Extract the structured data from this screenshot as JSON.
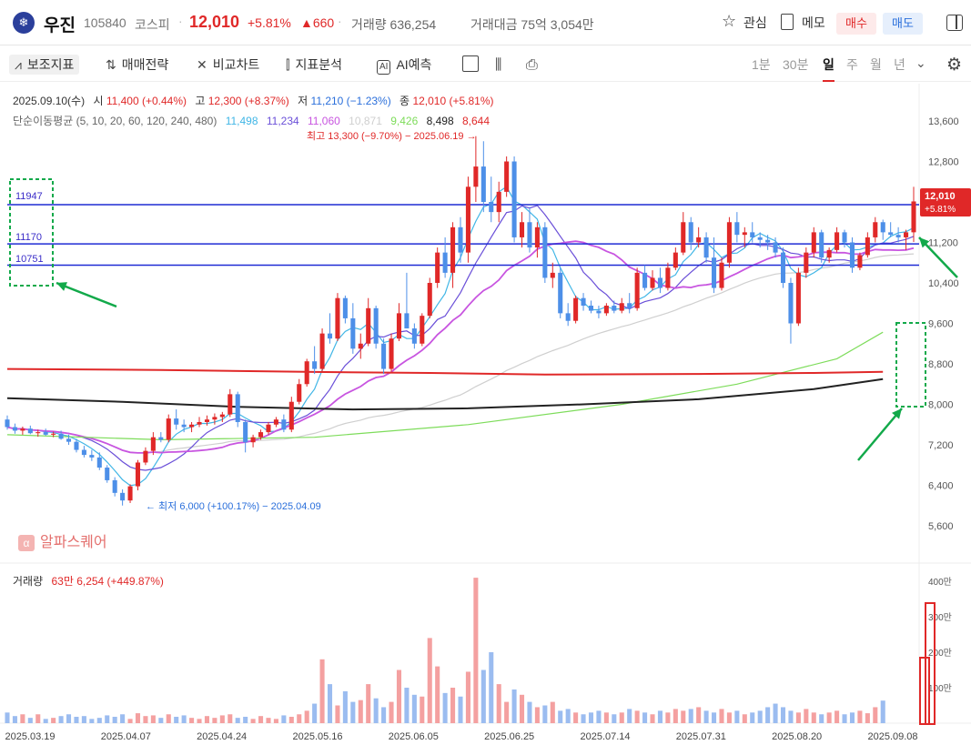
{
  "header": {
    "name": "우진",
    "code": "105840",
    "market": "코스피",
    "price": "12,010",
    "change_pct": "+5.81%",
    "change_abs": "▲660",
    "volume": "거래량 636,254",
    "amount": "거래대금 75억 3,054만",
    "watch_label": "관심",
    "memo_label": "메모",
    "buy_label": "매수",
    "sell_label": "매도"
  },
  "toolbar": {
    "indicators": "보조지표",
    "strategy": "매매전략",
    "compare": "비교차트",
    "analysis": "지표분석",
    "ai": "AI예측",
    "periods": [
      "1분",
      "30분",
      "일",
      "주",
      "월",
      "년"
    ],
    "active_period": "일"
  },
  "info": {
    "date": "2025.09.10(수)",
    "open_label": "시",
    "open": "11,400 (+0.44%)",
    "high_label": "고",
    "high": "12,300 (+8.37%)",
    "low_label": "저",
    "low": "11,210 (−1.23%)",
    "close_label": "종",
    "close": "12,010 (+5.81%)",
    "ma_label": "단순이동평균 (5, 10, 20, 60, 120, 240, 480)",
    "ma_values": [
      {
        "value": "11,498",
        "color": "#41b6e6"
      },
      {
        "value": "11,234",
        "color": "#6a4fd8"
      },
      {
        "value": "11,060",
        "color": "#c855e0"
      },
      {
        "value": "10,871",
        "color": "#cfcfcf"
      },
      {
        "value": "9,426",
        "color": "#7ddc5a"
      },
      {
        "value": "8,498",
        "color": "#222222"
      },
      {
        "value": "8,644",
        "color": "#e02828"
      }
    ]
  },
  "annotations": {
    "high": "최고 13,300 (−9.70%) − 2025.06.19 →",
    "low": "← 최저 6,000 (+100.17%) − 2025.04.09",
    "box_levels": [
      "11947",
      "11170",
      "10751"
    ],
    "price_tag": "12,010",
    "price_tag_pct": "+5.81%"
  },
  "watermark": "알파스퀘어",
  "volume_info": {
    "label": "거래량",
    "value": "63만 6,254 (+449.87%)"
  },
  "colors": {
    "up": "#e02828",
    "down": "#4d8fe8",
    "hline": "#1f2bd4",
    "annotation": "#12a94a"
  },
  "chart_data": {
    "type": "candlestick",
    "price_axis": {
      "ticks": [
        "13,600",
        "12,800",
        "12,000",
        "11,200",
        "10,400",
        "9,600",
        "8,800",
        "8,000",
        "7,200",
        "6,400",
        "5,600"
      ],
      "ylim": [
        5200,
        14000
      ]
    },
    "volume_axis": {
      "ticks": [
        "400만",
        "300만",
        "200만",
        "100만"
      ]
    },
    "x_ticks": [
      "2025.03.19",
      "2025.04.07",
      "2025.04.24",
      "2025.05.16",
      "2025.06.05",
      "2025.06.25",
      "2025.07.14",
      "2025.07.31",
      "2025.08.20",
      "2025.09.08"
    ],
    "horizontal_lines": [
      11947,
      11170,
      10751
    ],
    "ohlc": [
      [
        7700,
        7780,
        7500,
        7550
      ],
      [
        7550,
        7620,
        7420,
        7480
      ],
      [
        7480,
        7560,
        7400,
        7520
      ],
      [
        7520,
        7580,
        7410,
        7430
      ],
      [
        7430,
        7500,
        7360,
        7450
      ],
      [
        7450,
        7520,
        7380,
        7400
      ],
      [
        7400,
        7460,
        7350,
        7420
      ],
      [
        7420,
        7480,
        7300,
        7320
      ],
      [
        7320,
        7400,
        7200,
        7260
      ],
      [
        7260,
        7320,
        7050,
        7100
      ],
      [
        7100,
        7180,
        6950,
        7000
      ],
      [
        7000,
        7100,
        6880,
        6950
      ],
      [
        6950,
        7050,
        6700,
        6750
      ],
      [
        6750,
        6800,
        6450,
        6500
      ],
      [
        6500,
        6560,
        6180,
        6250
      ],
      [
        6250,
        6320,
        6000,
        6100
      ],
      [
        6100,
        6420,
        6050,
        6380
      ],
      [
        6380,
        6900,
        6300,
        6850
      ],
      [
        6850,
        7150,
        6800,
        7080
      ],
      [
        7080,
        7450,
        7000,
        7350
      ],
      [
        7350,
        7450,
        7250,
        7300
      ],
      [
        7300,
        7800,
        7250,
        7720
      ],
      [
        7720,
        7900,
        7500,
        7600
      ],
      [
        7600,
        7700,
        7450,
        7550
      ],
      [
        7550,
        7650,
        7450,
        7600
      ],
      [
        7600,
        7750,
        7550,
        7650
      ],
      [
        7650,
        7780,
        7580,
        7700
      ],
      [
        7700,
        7820,
        7600,
        7750
      ],
      [
        7750,
        7850,
        7650,
        7800
      ],
      [
        7800,
        8300,
        7750,
        8200
      ],
      [
        8200,
        8250,
        7550,
        7650
      ],
      [
        7650,
        7700,
        7050,
        7250
      ],
      [
        7250,
        7400,
        7150,
        7350
      ],
      [
        7350,
        7500,
        7300,
        7450
      ],
      [
        7450,
        7650,
        7400,
        7600
      ],
      [
        7600,
        7750,
        7550,
        7700
      ],
      [
        7700,
        7800,
        7450,
        7500
      ],
      [
        7500,
        8150,
        7450,
        8050
      ],
      [
        8050,
        8500,
        8000,
        8400
      ],
      [
        8400,
        8900,
        8350,
        8850
      ],
      [
        8850,
        9150,
        8600,
        8700
      ],
      [
        8700,
        9500,
        8650,
        9400
      ],
      [
        9400,
        9800,
        9200,
        9300
      ],
      [
        9300,
        10200,
        9250,
        10100
      ],
      [
        10100,
        10150,
        9600,
        9700
      ],
      [
        9700,
        10000,
        9000,
        9100
      ],
      [
        9100,
        9400,
        8900,
        9200
      ],
      [
        9200,
        10100,
        9150,
        9900
      ],
      [
        9900,
        9950,
        9100,
        9200
      ],
      [
        9200,
        9300,
        8600,
        8700
      ],
      [
        8700,
        9400,
        8650,
        9300
      ],
      [
        9300,
        10000,
        9250,
        9800
      ],
      [
        9800,
        10600,
        9600,
        9500
      ],
      [
        9500,
        9600,
        9100,
        9200
      ],
      [
        9200,
        9800,
        9150,
        9750
      ],
      [
        9750,
        10500,
        9700,
        10400
      ],
      [
        10400,
        11100,
        10300,
        11000
      ],
      [
        11000,
        11300,
        10500,
        10600
      ],
      [
        10600,
        11600,
        10300,
        11500
      ],
      [
        11500,
        11700,
        10800,
        11000
      ],
      [
        11000,
        12500,
        10800,
        12300
      ],
      [
        12300,
        13300,
        12000,
        12700
      ],
      [
        12700,
        13200,
        11800,
        12000
      ],
      [
        12000,
        12500,
        11600,
        11800
      ],
      [
        11800,
        12400,
        11600,
        12200
      ],
      [
        12200,
        12900,
        12100,
        12800
      ],
      [
        12800,
        12900,
        11200,
        11300
      ],
      [
        11300,
        11800,
        11100,
        11600
      ],
      [
        11600,
        11900,
        11000,
        11100
      ],
      [
        11100,
        11600,
        10900,
        11500
      ],
      [
        11500,
        11600,
        10400,
        10500
      ],
      [
        10500,
        10800,
        10300,
        10600
      ],
      [
        10600,
        10700,
        9700,
        9800
      ],
      [
        9800,
        10000,
        9550,
        9650
      ],
      [
        9650,
        10150,
        9600,
        10100
      ],
      [
        10100,
        10200,
        9850,
        9950
      ],
      [
        9950,
        10050,
        9800,
        9850
      ],
      [
        9850,
        9950,
        9700,
        9800
      ],
      [
        9800,
        10000,
        9750,
        9950
      ],
      [
        9950,
        10050,
        9800,
        9850
      ],
      [
        9850,
        10100,
        9800,
        10000
      ],
      [
        10000,
        10200,
        9800,
        9900
      ],
      [
        9900,
        10700,
        9850,
        10600
      ],
      [
        10600,
        10750,
        10250,
        10300
      ],
      [
        10300,
        10650,
        10250,
        10500
      ],
      [
        10500,
        10700,
        10200,
        10300
      ],
      [
        10300,
        10800,
        10250,
        10700
      ],
      [
        10700,
        11100,
        10650,
        11000
      ],
      [
        11000,
        11800,
        10950,
        11600
      ],
      [
        11600,
        11700,
        11050,
        11200
      ],
      [
        11200,
        11500,
        11100,
        11300
      ],
      [
        11300,
        11400,
        10800,
        10900
      ],
      [
        10900,
        11300,
        10200,
        10300
      ],
      [
        10300,
        10900,
        10250,
        10800
      ],
      [
        10800,
        11700,
        10700,
        11600
      ],
      [
        11600,
        11800,
        11200,
        11350
      ],
      [
        11350,
        11500,
        11100,
        11400
      ],
      [
        11400,
        11600,
        11200,
        11300
      ],
      [
        11300,
        11400,
        11100,
        11250
      ],
      [
        11250,
        11350,
        11050,
        11200
      ],
      [
        11200,
        11300,
        10900,
        11000
      ],
      [
        11000,
        11100,
        10300,
        10400
      ],
      [
        10400,
        10500,
        9200,
        9600
      ],
      [
        9600,
        10700,
        9550,
        10600
      ],
      [
        10600,
        11100,
        10500,
        11000
      ],
      [
        11000,
        11500,
        10900,
        11400
      ],
      [
        11400,
        11450,
        10800,
        10900
      ],
      [
        10900,
        11100,
        10800,
        11050
      ],
      [
        11050,
        11500,
        11000,
        11400
      ],
      [
        11400,
        11450,
        11100,
        11200
      ],
      [
        11200,
        11300,
        10600,
        10700
      ],
      [
        10700,
        11000,
        10650,
        10950
      ],
      [
        10950,
        11400,
        10900,
        11300
      ],
      [
        11300,
        11700,
        11200,
        11600
      ],
      [
        11600,
        11650,
        11250,
        11400
      ],
      [
        11400,
        11600,
        11300,
        11350
      ],
      [
        11350,
        11500,
        11200,
        11300
      ],
      [
        11300,
        11450,
        11050,
        11400
      ],
      [
        11400,
        12300,
        11210,
        12010
      ]
    ],
    "volume_man": [
      30,
      20,
      25,
      15,
      25,
      12,
      15,
      20,
      25,
      18,
      20,
      12,
      15,
      22,
      18,
      25,
      12,
      28,
      20,
      22,
      15,
      25,
      18,
      22,
      15,
      12,
      20,
      15,
      22,
      25,
      15,
      18,
      12,
      20,
      15,
      12,
      22,
      18,
      25,
      35,
      55,
      180,
      110,
      50,
      90,
      60,
      65,
      110,
      70,
      45,
      60,
      150,
      100,
      80,
      75,
      240,
      160,
      85,
      100,
      75,
      145,
      410,
      150,
      200,
      110,
      60,
      95,
      80,
      60,
      45,
      50,
      60,
      35,
      40,
      30,
      25,
      30,
      35,
      30,
      25,
      30,
      40,
      35,
      30,
      25,
      35,
      30,
      40,
      35,
      40,
      45,
      35,
      30,
      40,
      30,
      35,
      25,
      30,
      35,
      45,
      55,
      45,
      35,
      30,
      40,
      30,
      25,
      30,
      35,
      25,
      30,
      35,
      28,
      45,
      63.6
    ]
  }
}
